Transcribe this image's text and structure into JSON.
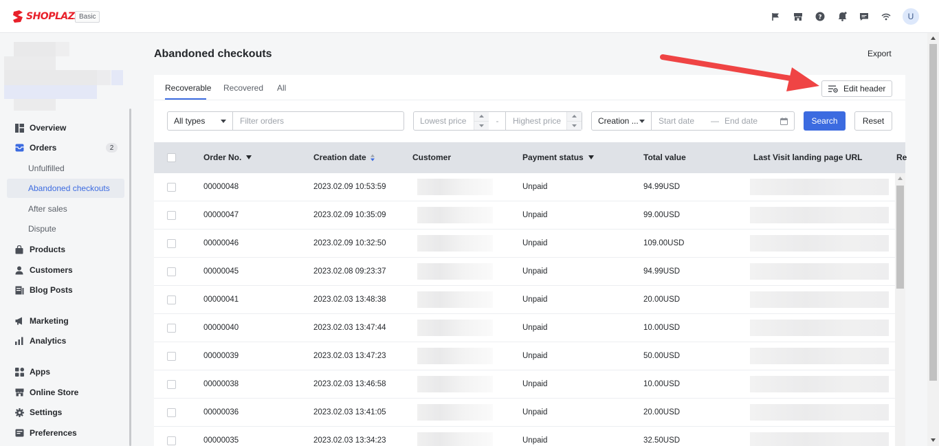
{
  "brand": {
    "name": "SHOPLAZZA",
    "plan_badge": "Basic",
    "color": "#e8202a"
  },
  "topbar": {
    "icons": [
      "flag-icon",
      "store-icon",
      "help-icon",
      "bell-icon",
      "message-icon",
      "wifi-icon"
    ],
    "avatar_initial": "U"
  },
  "sidebar": {
    "items": [
      {
        "label": "Overview",
        "icon": "overview-icon"
      },
      {
        "label": "Orders",
        "icon": "orders-icon",
        "count": "2"
      },
      {
        "label": "Unfulfilled",
        "sub": true
      },
      {
        "label": "Abandoned checkouts",
        "sub": true,
        "active": true
      },
      {
        "label": "After sales",
        "sub": true
      },
      {
        "label": "Dispute",
        "sub": true
      },
      {
        "label": "Products",
        "icon": "products-icon"
      },
      {
        "label": "Customers",
        "icon": "customers-icon"
      },
      {
        "label": "Blog Posts",
        "icon": "blog-icon"
      },
      {
        "label": "Marketing",
        "icon": "marketing-icon"
      },
      {
        "label": "Analytics",
        "icon": "analytics-icon"
      },
      {
        "label": "Apps",
        "icon": "apps-icon"
      },
      {
        "label": "Online Store",
        "icon": "store-icon"
      },
      {
        "label": "Settings",
        "icon": "settings-icon"
      },
      {
        "label": "Preferences",
        "icon": "preferences-icon"
      }
    ]
  },
  "page": {
    "title": "Abandoned checkouts",
    "export_label": "Export"
  },
  "tabs": [
    {
      "label": "Recoverable",
      "active": true
    },
    {
      "label": "Recovered"
    },
    {
      "label": "All"
    }
  ],
  "edit_header_label": "Edit header",
  "filters": {
    "type_select": "All types",
    "filter_placeholder": "Filter orders",
    "lowest_price_placeholder": "Lowest price",
    "price_separator": "-",
    "highest_price_placeholder": "Highest price",
    "date_type_select": "Creation ...",
    "start_date_placeholder": "Start date",
    "date_separator": "—",
    "end_date_placeholder": "End date",
    "search_label": "Search",
    "reset_label": "Reset"
  },
  "table": {
    "columns": [
      "Order No.",
      "Creation date",
      "Customer",
      "Payment status",
      "Total value",
      "Last Visit landing page URL",
      "Re"
    ],
    "rows": [
      {
        "order_no": "00000048",
        "date": "2023.02.09 10:53:59",
        "status": "Unpaid",
        "total": "94.99USD"
      },
      {
        "order_no": "00000047",
        "date": "2023.02.09 10:35:09",
        "status": "Unpaid",
        "total": "99.00USD"
      },
      {
        "order_no": "00000046",
        "date": "2023.02.09 10:32:50",
        "status": "Unpaid",
        "total": "109.00USD"
      },
      {
        "order_no": "00000045",
        "date": "2023.02.08 09:23:37",
        "status": "Unpaid",
        "total": "94.99USD"
      },
      {
        "order_no": "00000041",
        "date": "2023.02.03 13:48:38",
        "status": "Unpaid",
        "total": "20.00USD"
      },
      {
        "order_no": "00000040",
        "date": "2023.02.03 13:47:44",
        "status": "Unpaid",
        "total": "10.00USD"
      },
      {
        "order_no": "00000039",
        "date": "2023.02.03 13:47:23",
        "status": "Unpaid",
        "total": "50.00USD"
      },
      {
        "order_no": "00000038",
        "date": "2023.02.03 13:46:58",
        "status": "Unpaid",
        "total": "10.00USD"
      },
      {
        "order_no": "00000036",
        "date": "2023.02.03 13:41:05",
        "status": "Unpaid",
        "total": "20.00USD"
      },
      {
        "order_no": "00000035",
        "date": "2023.02.03 13:34:23",
        "status": "Unpaid",
        "total": "32.50USD"
      }
    ]
  },
  "colors": {
    "accent": "#3c6be0",
    "annotation_arrow": "#ef4444"
  }
}
